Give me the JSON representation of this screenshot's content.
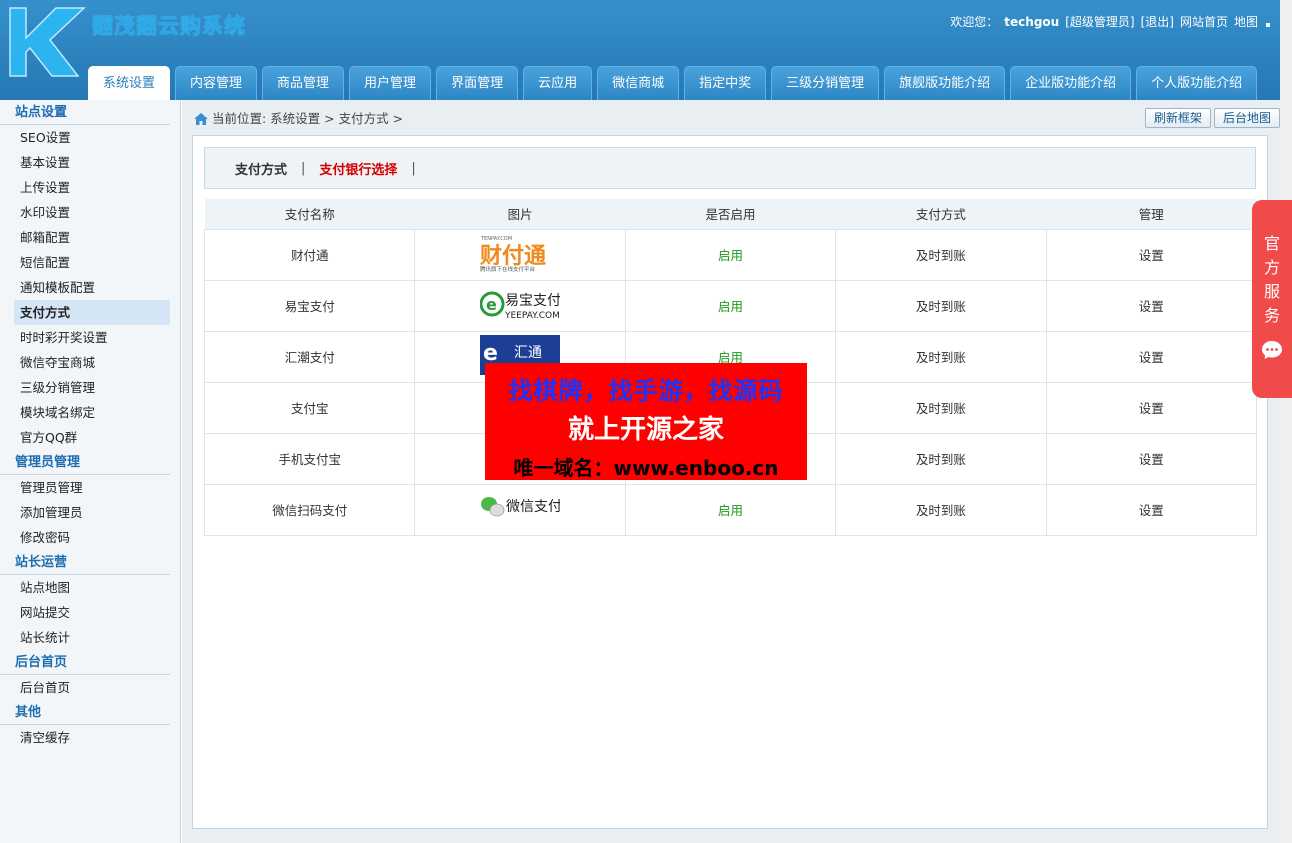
{
  "header": {
    "logo_text": "翻茂翻云购系统",
    "welcome": "欢迎您：",
    "username": "techgou",
    "role": "[超级管理员]",
    "logout": "[退出]",
    "site_home": "网站首页",
    "map": "地图"
  },
  "nav": {
    "tabs": [
      {
        "label": "系统设置",
        "active": true
      },
      {
        "label": "内容管理"
      },
      {
        "label": "商品管理"
      },
      {
        "label": "用户管理"
      },
      {
        "label": "界面管理"
      },
      {
        "label": "云应用"
      },
      {
        "label": "微信商城"
      },
      {
        "label": "指定中奖"
      },
      {
        "label": "三级分销管理"
      },
      {
        "label": "旗舰版功能介绍"
      },
      {
        "label": "企业版功能介绍"
      },
      {
        "label": "个人版功能介绍"
      }
    ]
  },
  "sidebar": {
    "groups": [
      {
        "title": "站点设置",
        "items": [
          "SEO设置",
          "基本设置",
          "上传设置",
          "水印设置",
          "邮箱配置",
          "短信配置",
          "通知模板配置",
          "支付方式",
          "时时彩开奖设置",
          "微信夺宝商城",
          "三级分销管理",
          "模块域名绑定",
          "官方QQ群"
        ]
      },
      {
        "title": "管理员管理",
        "items": [
          "管理员管理",
          "添加管理员",
          "修改密码"
        ]
      },
      {
        "title": "站长运营",
        "items": [
          "站点地图",
          "网站提交",
          "站长统计"
        ]
      },
      {
        "title": "后台首页",
        "items": [
          "后台首页"
        ]
      },
      {
        "title": "其他",
        "items": [
          "清空缓存"
        ]
      }
    ],
    "active_item": "支付方式"
  },
  "breadcrumb": {
    "text": "当前位置: 系统设置 > 支付方式 >"
  },
  "top_buttons": {
    "refresh": "刷新框架",
    "backend_map": "后台地图"
  },
  "subtabs": {
    "tab1": "支付方式",
    "sep": "|",
    "tab2": "支付银行选择",
    "sep2": "|"
  },
  "table": {
    "headers": [
      "支付名称",
      "图片",
      "是否启用",
      "支付方式",
      "管理"
    ],
    "rows": [
      {
        "name": "财付通",
        "logo": "tenpay-logo",
        "enabled": "启用",
        "method": "及时到账",
        "manage": "设置"
      },
      {
        "name": "易宝支付",
        "logo": "yeepay-logo",
        "enabled": "启用",
        "method": "及时到账",
        "manage": "设置"
      },
      {
        "name": "汇潮支付",
        "logo": "ecpss-logo",
        "enabled": "启用",
        "method": "及时到账",
        "manage": "设置"
      },
      {
        "name": "支付宝",
        "logo": "",
        "enabled": "",
        "method": "及时到账",
        "manage": "设置"
      },
      {
        "name": "手机支付宝",
        "logo": "",
        "enabled": "",
        "method": "及时到账",
        "manage": "设置"
      },
      {
        "name": "微信扫码支付",
        "logo": "wechat-pay-logo",
        "enabled": "启用",
        "method": "及时到账",
        "manage": "设置"
      }
    ],
    "logo_texts": {
      "tenpay_small": "TENPAY.COM",
      "tenpay_main": "财付通",
      "tenpay_sub": "腾讯旗下在线支付平台",
      "yeepay_main": "易宝支付",
      "yeepay_sub": "YEEPAY.COM",
      "ecpss": "汇通",
      "wechat": "微信支付"
    }
  },
  "ad": {
    "line1": "找棋牌，找手游，找源码",
    "line2": "就上开源之家",
    "line3": "唯一域名：www.enboo.cn"
  },
  "service": {
    "label": "官方服务"
  },
  "colors": {
    "header": "#2a7fba",
    "active_text": "#1a9a1a",
    "accent_red": "#d40000",
    "service_bg": "#f04a4a"
  }
}
